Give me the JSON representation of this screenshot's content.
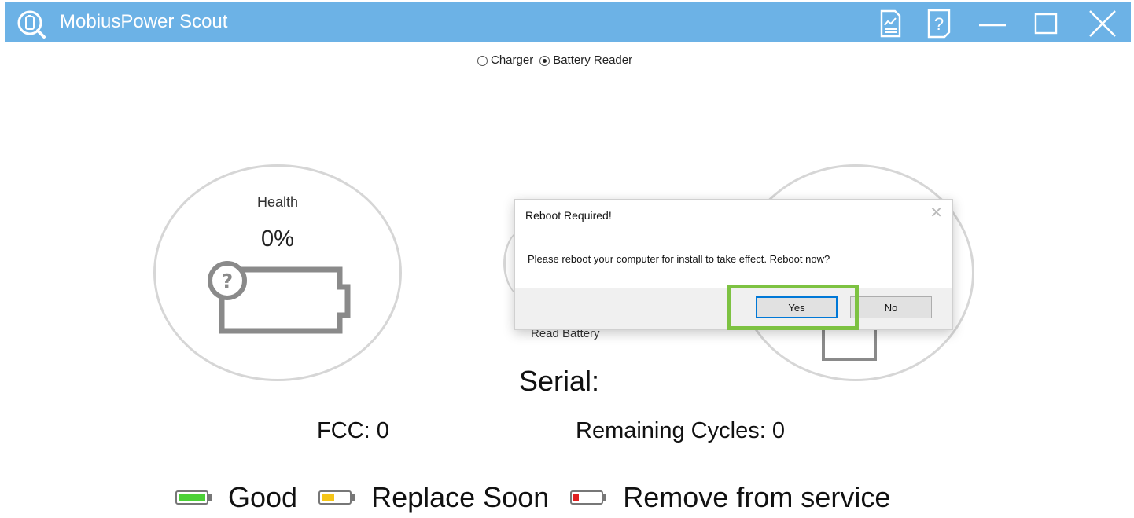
{
  "window": {
    "title": "MobiusPower Scout",
    "accent_color": "#6cb2e6"
  },
  "mode": {
    "options": [
      "Charger",
      "Battery Reader"
    ],
    "selected": "Battery Reader"
  },
  "health": {
    "label": "Health",
    "value": "0%",
    "icon": "unknown-battery-icon"
  },
  "read_battery_label": "Read Battery",
  "serial_label": "Serial:",
  "fcc_label": "FCC: 0",
  "cycles_label": "Remaining Cycles: 0",
  "legend": {
    "good": "Good",
    "replace": "Replace Soon",
    "remove": "Remove from service",
    "colors": {
      "good": "#4cd137",
      "replace": "#f5c518",
      "remove": "#e02020"
    }
  },
  "dialog": {
    "title": "Reboot Required!",
    "message": "Please reboot your computer for install to take effect. Reboot now?",
    "yes": "Yes",
    "no": "No",
    "highlight_color": "#7dc242"
  }
}
